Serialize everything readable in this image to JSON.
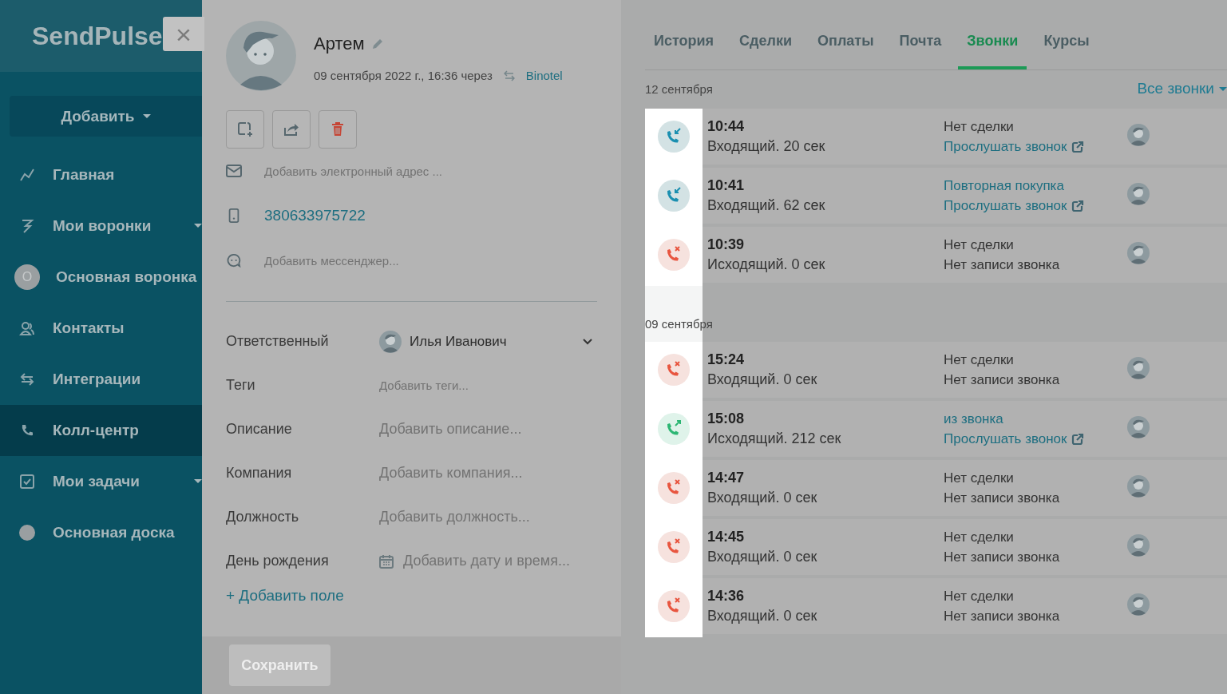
{
  "logo": "SendPulse",
  "close_button": "×",
  "sidebar": {
    "add_button": "Добавить",
    "items": [
      {
        "kind": "chart",
        "label": "Главная",
        "caret": false,
        "selected": false
      },
      {
        "kind": "funnel",
        "label": "Мои воронки",
        "caret": true,
        "selected": false
      },
      {
        "kind": "initial",
        "badge": "О",
        "label": "Основная воронка",
        "caret": false,
        "selected": false
      },
      {
        "kind": "contacts",
        "label": "Контакты",
        "caret": false,
        "selected": false
      },
      {
        "kind": "arrows",
        "label": "Интеграции",
        "caret": false,
        "selected": false
      },
      {
        "kind": "phone",
        "label": "Колл-центр",
        "caret": false,
        "selected": true
      },
      {
        "kind": "checkbox",
        "label": "Мои задачи",
        "caret": true,
        "selected": false
      },
      {
        "kind": "dot",
        "label": "Основная доска",
        "caret": false,
        "selected": false
      }
    ]
  },
  "contact": {
    "name": "Артем",
    "created": "09 сентября 2022 г., 16:36 через",
    "source": "Binotel",
    "email": {
      "placeholder": "Добавить электронный адрес ..."
    },
    "phone": "380633975722",
    "messenger": {
      "placeholder": "Добавить мессенджер..."
    },
    "fields": [
      {
        "kind": "user",
        "label": "Ответственный",
        "value": "Илья Иванович"
      },
      {
        "kind": "text",
        "label": "Теги",
        "placeholder": "Добавить теги..."
      },
      {
        "kind": "text",
        "label": "Описание",
        "placeholder": "Добавить описание..."
      },
      {
        "kind": "text",
        "label": "Компания",
        "placeholder": "Добавить компания..."
      },
      {
        "kind": "text",
        "label": "Должность",
        "placeholder": "Добавить должность..."
      },
      {
        "kind": "date",
        "label": "День рождения",
        "placeholder": "Добавить дату и время..."
      }
    ],
    "add_field": "+ Добавить поле",
    "save_button": {
      "label": "Сохранить",
      "disabled": true
    }
  },
  "tabs": [
    {
      "label": "История",
      "selected": false
    },
    {
      "label": "Сделки",
      "selected": false
    },
    {
      "label": "Оплаты",
      "selected": false
    },
    {
      "label": "Почта",
      "selected": false
    },
    {
      "label": "Звонки",
      "selected": true
    },
    {
      "label": "Курсы",
      "selected": false
    }
  ],
  "filter": "Все звонки",
  "call_groups": [
    {
      "date": "12 сентября",
      "calls": [
        {
          "kind": "incoming",
          "time": "10:44",
          "summary": "Входящий. 20 сек",
          "deal": "Нет сделки",
          "deal_link": false,
          "record": "Прослушать звонок",
          "record_link": true
        },
        {
          "kind": "incoming",
          "time": "10:41",
          "summary": "Входящий. 62 сек",
          "deal": "Повторная покупка",
          "deal_link": true,
          "record": "Прослушать звонок",
          "record_link": true
        },
        {
          "kind": "missed",
          "time": "10:39",
          "summary": "Исходящий. 0 сек",
          "deal": "Нет сделки",
          "deal_link": false,
          "record": "Нет записи звонка",
          "record_link": false
        }
      ]
    },
    {
      "date": "09 сентября",
      "calls": [
        {
          "kind": "missed",
          "time": "15:24",
          "summary": "Входящий. 0 сек",
          "deal": "Нет сделки",
          "deal_link": false,
          "record": "Нет записи звонка",
          "record_link": false
        },
        {
          "kind": "outgoing",
          "time": "15:08",
          "summary": "Исходящий. 212 сек",
          "deal": "из звонка",
          "deal_link": true,
          "record": "Прослушать звонок",
          "record_link": true
        },
        {
          "kind": "missed",
          "time": "14:47",
          "summary": "Входящий. 0 сек",
          "deal": "Нет сделки",
          "deal_link": false,
          "record": "Нет записи звонка",
          "record_link": false
        },
        {
          "kind": "missed",
          "time": "14:45",
          "summary": "Входящий. 0 сек",
          "deal": "Нет сделки",
          "deal_link": false,
          "record": "Нет записи звонка",
          "record_link": false
        },
        {
          "kind": "missed",
          "time": "14:36",
          "summary": "Входящий. 0 сек",
          "deal": "Нет сделки",
          "deal_link": false,
          "record": "Нет записи звонка",
          "record_link": false
        }
      ]
    }
  ]
}
